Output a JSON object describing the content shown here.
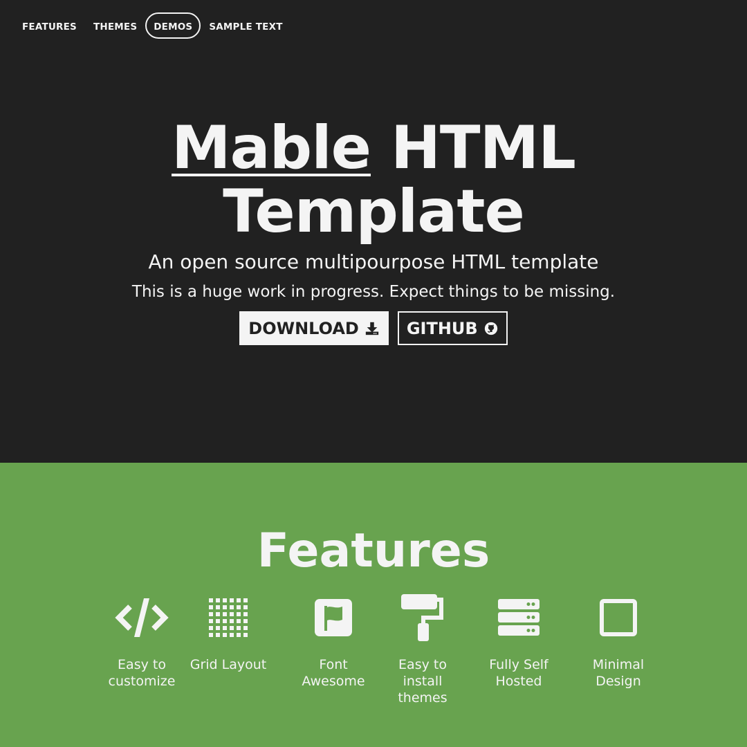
{
  "nav": {
    "items": [
      {
        "label": "FEATURES"
      },
      {
        "label": "THEMES"
      },
      {
        "label": "DEMOS"
      },
      {
        "label": "SAMPLE TEXT"
      }
    ]
  },
  "hero": {
    "title_link": "Mable",
    "title_rest": " HTML",
    "title_line2": "Template",
    "subtitle": "An open source multipourpose HTML template",
    "note": "This is a huge work in progress. Expect things to be missing.",
    "download_label": "DOWNLOAD",
    "github_label": "GITHUB"
  },
  "features": {
    "title": "Features",
    "items": [
      {
        "label": "Easy to customize",
        "icon": "code-icon"
      },
      {
        "label": "Grid Layout",
        "icon": "grid-icon"
      },
      {
        "label": "Font Awesome",
        "icon": "flag-icon"
      },
      {
        "label": "Easy to install themes",
        "icon": "paint-roller-icon"
      },
      {
        "label": "Fully Self Hosted",
        "icon": "server-icon"
      },
      {
        "label": "Minimal Design",
        "icon": "square-icon"
      }
    ]
  },
  "colors": {
    "hero_bg": "#212121",
    "features_bg": "#68a34f",
    "text": "#f4f4f4"
  }
}
